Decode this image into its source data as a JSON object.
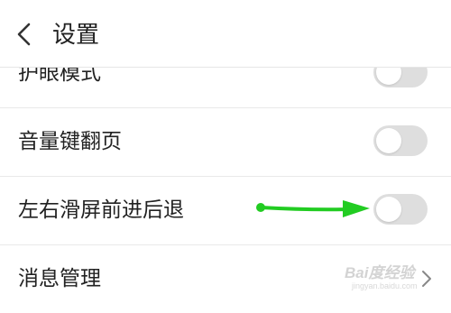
{
  "header": {
    "title": "设置",
    "back_icon": "chevron-left-icon"
  },
  "settings": [
    {
      "label": "护眼模式",
      "control": "toggle",
      "on": false
    },
    {
      "label": "音量键翻页",
      "control": "toggle",
      "on": false
    },
    {
      "label": "左右滑屏前进后退",
      "control": "toggle",
      "on": false
    },
    {
      "label": "消息管理",
      "control": "chevron"
    }
  ],
  "annotation": {
    "type": "arrow",
    "color": "#22cc22"
  },
  "watermark": {
    "main": "Bai度经验",
    "sub": "jingyan.baidu.com"
  },
  "colors": {
    "toggle_off": "#dedede",
    "divider": "#e9e9e9",
    "text": "#222222"
  }
}
